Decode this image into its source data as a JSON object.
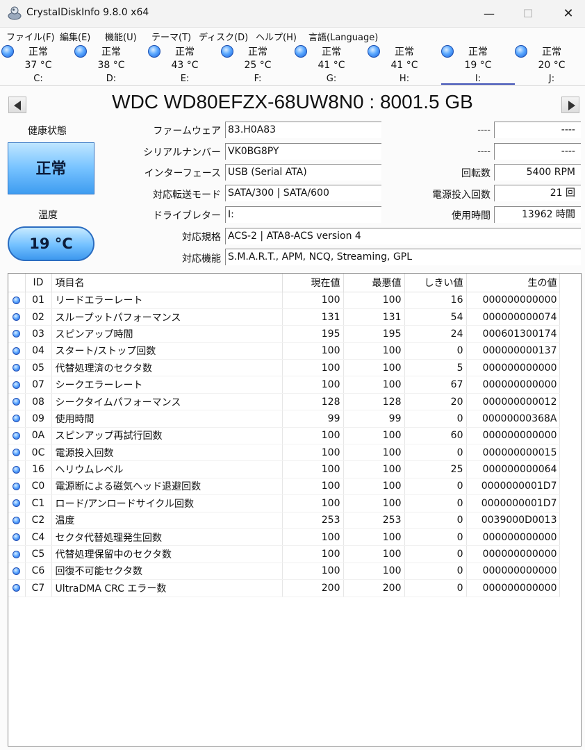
{
  "window": {
    "title": "CrystalDiskInfo 9.8.0 x64",
    "minimize_glyph": "—",
    "maximize_glyph": "☐",
    "close_glyph": "✕"
  },
  "menu": [
    "ファイル(F)",
    "編集(E)",
    "機能(U)",
    "テーマ(T)",
    "ディスク(D)",
    "ヘルプ(H)",
    "言語(Language)"
  ],
  "drives": [
    {
      "status": "正常",
      "temp": "37 °C",
      "letter": "C:"
    },
    {
      "status": "正常",
      "temp": "38 °C",
      "letter": "D:"
    },
    {
      "status": "正常",
      "temp": "43 °C",
      "letter": "E:"
    },
    {
      "status": "正常",
      "temp": "25 °C",
      "letter": "F:"
    },
    {
      "status": "正常",
      "temp": "41 °C",
      "letter": "G:"
    },
    {
      "status": "正常",
      "temp": "41 °C",
      "letter": "H:"
    },
    {
      "status": "正常",
      "temp": "19 °C",
      "letter": "I:"
    },
    {
      "status": "正常",
      "temp": "20 °C",
      "letter": "J:"
    }
  ],
  "active_drive": "I:",
  "model": "WDC WD80EFZX-68UW8N0 : 8001.5 GB",
  "health": {
    "label": "健康状態",
    "value": "正常"
  },
  "temperature": {
    "label": "温度",
    "value": "19 °C"
  },
  "info": {
    "firmware_label": "ファームウェア",
    "firmware": "83.H0A83",
    "serial_label": "シリアルナンバー",
    "serial": "VK0BG8PY",
    "interface_label": "インターフェース",
    "interface": "USB (Serial ATA)",
    "transfer_label": "対応転送モード",
    "transfer": "SATA/300 | SATA/600",
    "drive_letter_label": "ドライブレター",
    "drive_letter": "I:",
    "standard_label": "対応規格",
    "standard": "ACS-2 | ATA8-ACS version 4",
    "features_label": "対応機能",
    "features": "S.M.A.R.T., APM, NCQ, Streaming, GPL",
    "dash1_label": "----",
    "dash1_value": "----",
    "dash2_label": "----",
    "dash2_value": "----",
    "rotation_label": "回転数",
    "rotation": "5400 RPM",
    "power_count_label": "電源投入回数",
    "power_count": "21 回",
    "hours_label": "使用時間",
    "hours": "13962 時間"
  },
  "smart": {
    "headers": {
      "id": "ID",
      "name": "項目名",
      "current": "現在値",
      "worst": "最悪値",
      "threshold": "しきい値",
      "raw": "生の値"
    },
    "rows": [
      {
        "id": "01",
        "name": "リードエラーレート",
        "current": "100",
        "worst": "100",
        "threshold": "16",
        "raw": "000000000000"
      },
      {
        "id": "02",
        "name": "スループットパフォーマンス",
        "current": "131",
        "worst": "131",
        "threshold": "54",
        "raw": "000000000074"
      },
      {
        "id": "03",
        "name": "スピンアップ時間",
        "current": "195",
        "worst": "195",
        "threshold": "24",
        "raw": "000601300174"
      },
      {
        "id": "04",
        "name": "スタート/ストップ回数",
        "current": "100",
        "worst": "100",
        "threshold": "0",
        "raw": "000000000137"
      },
      {
        "id": "05",
        "name": "代替処理済のセクタ数",
        "current": "100",
        "worst": "100",
        "threshold": "5",
        "raw": "000000000000"
      },
      {
        "id": "07",
        "name": "シークエラーレート",
        "current": "100",
        "worst": "100",
        "threshold": "67",
        "raw": "000000000000"
      },
      {
        "id": "08",
        "name": "シークタイムパフォーマンス",
        "current": "128",
        "worst": "128",
        "threshold": "20",
        "raw": "000000000012"
      },
      {
        "id": "09",
        "name": "使用時間",
        "current": "99",
        "worst": "99",
        "threshold": "0",
        "raw": "00000000368A"
      },
      {
        "id": "0A",
        "name": "スピンアップ再試行回数",
        "current": "100",
        "worst": "100",
        "threshold": "60",
        "raw": "000000000000"
      },
      {
        "id": "0C",
        "name": "電源投入回数",
        "current": "100",
        "worst": "100",
        "threshold": "0",
        "raw": "000000000015"
      },
      {
        "id": "16",
        "name": "ヘリウムレベル",
        "current": "100",
        "worst": "100",
        "threshold": "25",
        "raw": "000000000064"
      },
      {
        "id": "C0",
        "name": "電源断による磁気ヘッド退避回数",
        "current": "100",
        "worst": "100",
        "threshold": "0",
        "raw": "0000000001D7"
      },
      {
        "id": "C1",
        "name": "ロード/アンロードサイクル回数",
        "current": "100",
        "worst": "100",
        "threshold": "0",
        "raw": "0000000001D7"
      },
      {
        "id": "C2",
        "name": "温度",
        "current": "253",
        "worst": "253",
        "threshold": "0",
        "raw": "0039000D0013"
      },
      {
        "id": "C4",
        "name": "セクタ代替処理発生回数",
        "current": "100",
        "worst": "100",
        "threshold": "0",
        "raw": "000000000000"
      },
      {
        "id": "C5",
        "name": "代替処理保留中のセクタ数",
        "current": "100",
        "worst": "100",
        "threshold": "0",
        "raw": "000000000000"
      },
      {
        "id": "C6",
        "name": "回復不可能セクタ数",
        "current": "100",
        "worst": "100",
        "threshold": "0",
        "raw": "000000000000"
      },
      {
        "id": "C7",
        "name": "UltraDMA CRC エラー数",
        "current": "200",
        "worst": "200",
        "threshold": "0",
        "raw": "000000000000"
      }
    ]
  },
  "colors": {
    "status_good": "#4a9cf5",
    "active_tab_underline": "#3d4fb4"
  }
}
